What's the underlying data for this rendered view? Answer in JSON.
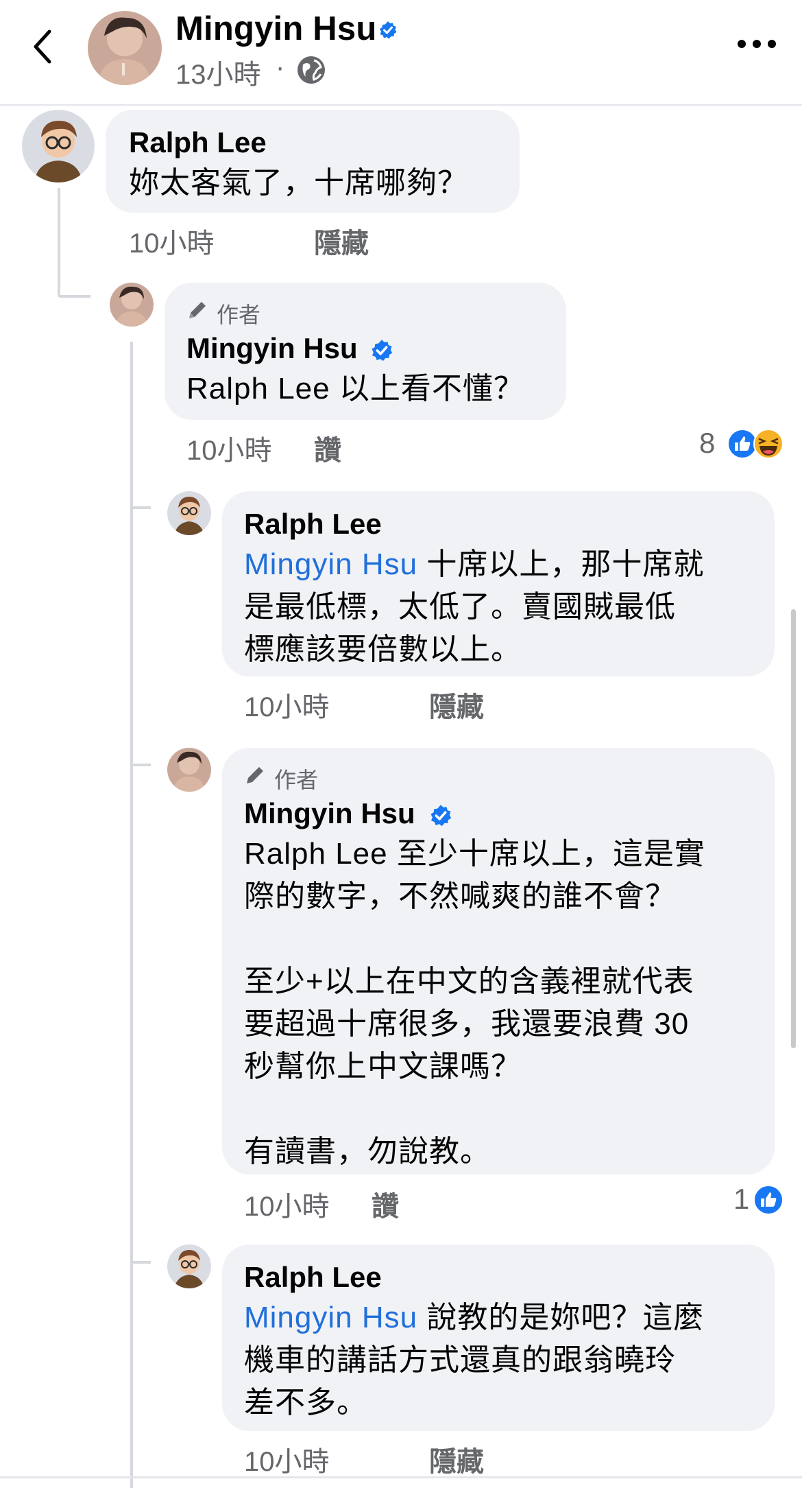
{
  "header": {
    "name": "Mingyin Hsu",
    "time": "13小時",
    "dot": "·"
  },
  "comments": [
    {
      "name": "Ralph Lee",
      "text": "妳太客氣了，十席哪夠？",
      "time": "10小時",
      "action": "隱藏"
    },
    {
      "author_badge": "作者",
      "name": "Mingyin Hsu",
      "text": "Ralph Lee 以上看不懂？",
      "time": "10小時",
      "action": "讚",
      "reactions": "8"
    },
    {
      "name": "Ralph Lee",
      "mention": "Mingyin Hsu",
      "text_line1": " 十席以上，那十席就",
      "text_rest": "是最低標，太低了。賣國賊最低\n標應該要倍數以上。",
      "time": "10小時",
      "action": "隱藏"
    },
    {
      "author_badge": "作者",
      "name": "Mingyin Hsu",
      "text": "Ralph Lee 至少十席以上，這是實\n際的數字，不然喊爽的誰不會？\n\n至少+以上在中文的含義裡就代表\n要超過十席很多，我還要浪費 30\n秒幫你上中文課嗎？\n\n有讀書，勿說教。",
      "time": "10小時",
      "action": "讚",
      "reactions": "1"
    },
    {
      "name": "Ralph Lee",
      "mention": "Mingyin Hsu",
      "text_line1": " 說教的是妳吧？這麼",
      "text_rest": "機車的講話方式還真的跟翁曉玲\n差不多。",
      "time": "10小時",
      "action": "隱藏"
    }
  ],
  "colors": {
    "bubble": "#f0f2f5",
    "mention": "#216fdb",
    "verified": "#1877f2",
    "secondary_text": "#65676b"
  }
}
